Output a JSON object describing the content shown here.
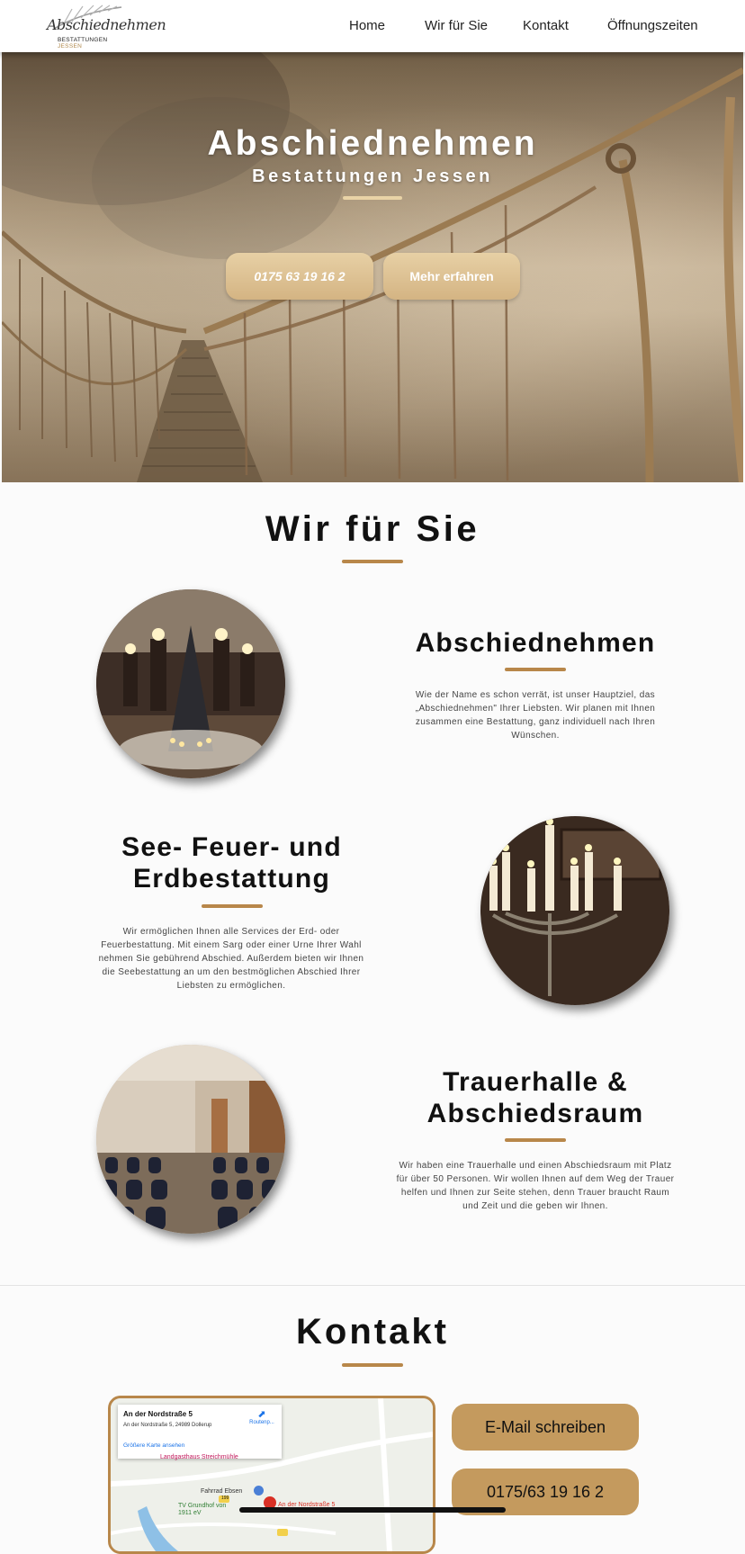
{
  "nav": {
    "logo_script": "Abschiednehmen",
    "logo_sub_bold": "BESTATTUNGEN",
    "logo_sub_light": "JESSEN",
    "links": [
      "Home",
      "Wir für Sie",
      "Kontakt",
      "Öffnungszeiten"
    ]
  },
  "hero": {
    "title": "Abschiednehmen",
    "subtitle": "Bestattungen Jessen",
    "phone_button": "0175 63 19 16 2",
    "more_button": "Mehr erfahren"
  },
  "services": {
    "title": "Wir für Sie",
    "items": [
      {
        "title": "Abschiednehmen",
        "text": "Wie der Name es schon verrät, ist unser Hauptziel, das „Abschiednehmen\" Ihrer Liebsten. Wir planen mit Ihnen zusammen eine Bestattung, ganz individuell nach Ihren Wünschen."
      },
      {
        "title_line1": "See- Feuer- und",
        "title_line2": "Erdbestattung",
        "text": "Wir ermöglichen Ihnen alle Services der Erd- oder Feuerbestattung. Mit einem Sarg oder einer Urne Ihrer Wahl nehmen Sie gebührend Abschied. Außerdem bieten wir Ihnen die Seebestattung an um den bestmöglichen Abschied Ihrer Liebsten zu ermöglichen."
      },
      {
        "title_line1": "Trauerhalle &",
        "title_line2": "Abschiedsraum",
        "text": "Wir haben eine Trauerhalle und einen Abschiedsraum mit Platz für über 50 Personen. Wir wollen Ihnen auf dem Weg der Trauer helfen und Ihnen zur Seite stehen, denn Trauer braucht Raum und Zeit und die geben wir Ihnen."
      }
    ]
  },
  "contact": {
    "title": "Kontakt",
    "map": {
      "place_name": "An der Nordstraße 5",
      "address": "An der Nordstraße 5, 24989 Dollerup",
      "route_label": "Routenp...",
      "larger_map_link": "Größere Karte ansehen",
      "labels": [
        "Landgasthaus Streichmühle",
        "Fahrrad Ebsen",
        "TV Grundhof von 1911 eV",
        "An der Nordstraße 5",
        "199"
      ]
    },
    "email_button": "E-Mail schreiben",
    "phone_button": "0175/63 19 16 2"
  }
}
